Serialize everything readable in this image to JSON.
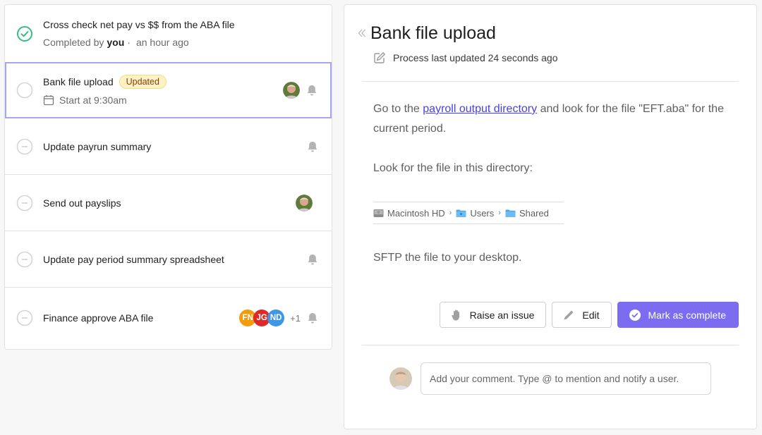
{
  "tasks": [
    {
      "title": "Cross check net pay vs $$ from the ABA file",
      "status": "completed",
      "completed_prefix": "Completed by",
      "completed_by": "you",
      "separator": "·",
      "completed_when": "an hour ago"
    },
    {
      "title": "Bank file upload",
      "status": "open",
      "badge": "Updated",
      "start_label": "Start at 9:30am",
      "has_avatar": true,
      "has_bell": true,
      "selected": true
    },
    {
      "title": "Update payrun summary",
      "status": "not-started",
      "has_bell": true
    },
    {
      "title": "Send out payslips",
      "status": "not-started",
      "has_avatar": true
    },
    {
      "title": "Update pay period summary spreadsheet",
      "status": "not-started",
      "has_bell": true
    },
    {
      "title": "Finance approve ABA file",
      "status": "not-started",
      "assignees": [
        {
          "initials": "FN",
          "color": "#f29b0c"
        },
        {
          "initials": "JG",
          "color": "#dc2a2a"
        },
        {
          "initials": "ND",
          "color": "#3d96e6"
        }
      ],
      "more_count": "+1",
      "has_bell": true
    }
  ],
  "detail": {
    "title": "Bank file upload",
    "last_updated": "Process last updated 24 seconds ago",
    "para1_before": "Go to the ",
    "para1_link": "payroll output directory",
    "para1_after": " and look for the file \"EFT.aba\" for the current period.",
    "para2": "Look for the file in this directory:",
    "path": [
      {
        "label": "Macintosh HD",
        "icon": "hard-drive-icon"
      },
      {
        "label": "Users",
        "icon": "users-folder-icon"
      },
      {
        "label": "Shared",
        "icon": "folder-icon"
      }
    ],
    "path_separator": "›",
    "para3": "SFTP the file to your desktop.",
    "actions": {
      "raise_issue": "Raise an issue",
      "edit": "Edit",
      "mark_complete": "Mark as complete"
    },
    "comment_placeholder": "Add your comment. Type @ to mention and notify a user."
  },
  "colors": {
    "accent": "#7b6cf0",
    "link": "#4a3fe0",
    "completed": "#3dba84",
    "selected_border": "#a5a6f6",
    "badge_bg": "#fdf2c4",
    "badge_text": "#8a3a0e"
  }
}
